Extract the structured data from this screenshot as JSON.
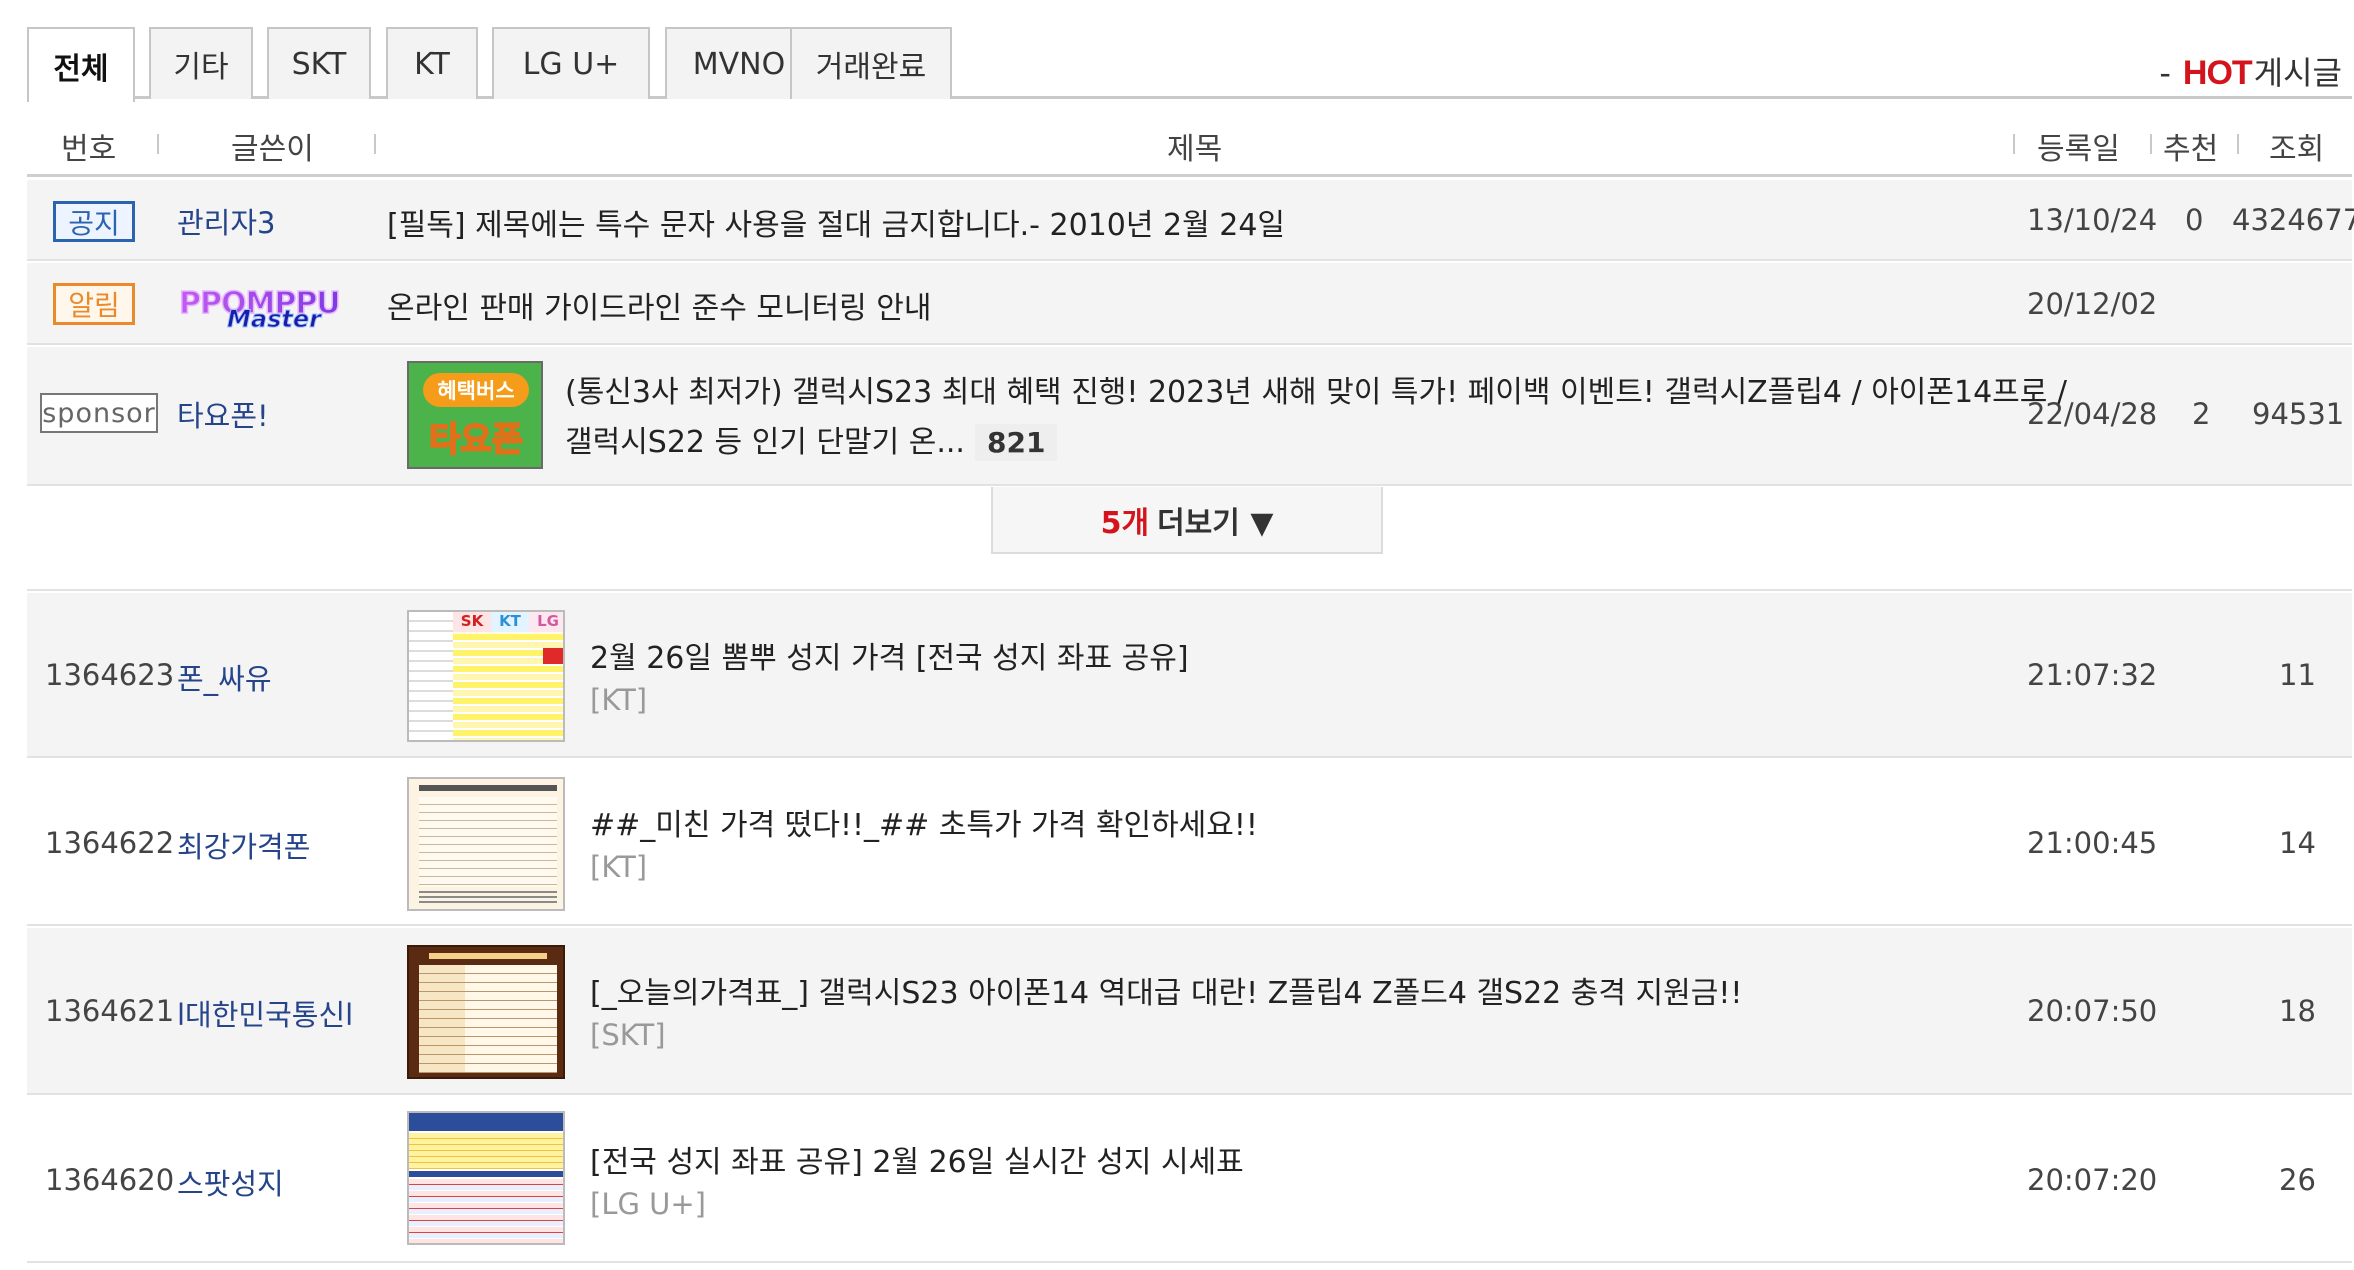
{
  "tabs": [
    {
      "label": "전체",
      "active": true
    },
    {
      "label": "기타"
    },
    {
      "label": "SKT"
    },
    {
      "label": "KT"
    },
    {
      "label": "LG U+"
    },
    {
      "label": "MVNO"
    },
    {
      "label": "거래완료"
    }
  ],
  "hot_link": {
    "dash": "-",
    "hot": "HOT",
    "board": "게시글"
  },
  "columns": {
    "no": "번호",
    "writer": "글쓴이",
    "title": "제목",
    "date": "등록일",
    "rec": "추천",
    "views": "조회"
  },
  "notices": [
    {
      "badge": "공지",
      "writer": "관리자3",
      "title": "[필독] 제목에는 특수 문자 사용을 절대 금지합니다.- 2010년 2월 24일",
      "date": "13/10/24",
      "rec": "0",
      "views": "4324677"
    },
    {
      "badge": "알림",
      "writer_logo": "PPOMPPU Master",
      "title": "온라인 판매 가이드라인 준수 모니터링 안내",
      "date": "20/12/02"
    },
    {
      "badge": "sponsor",
      "writer": "타요폰!",
      "thumb_text": [
        "혜택버스",
        "타요폰"
      ],
      "title_line1": "(통신3사 최저가) 갤럭시S23 최대 혜택 진행! 2023년 새해 맞이 특가! 페이백 이벤트! 갤럭시Z플립4 / 아이폰14프로 /",
      "title_line2": "갤럭시S22 등 인기 단말기 온...",
      "comments": "821",
      "date": "22/04/28",
      "rec": "2",
      "views": "94531"
    }
  ],
  "more": {
    "count": "5개",
    "label": "더보기 ▼"
  },
  "posts": [
    {
      "no": "1364623",
      "writer": "폰_싸유",
      "title": "2월 26일 뽐뿌 성지 가격 [전국 성지 좌표 공유]",
      "category": "[KT]",
      "time": "21:07:32",
      "views": "11",
      "thumb_headers": [
        "SK",
        "KT",
        "LG"
      ]
    },
    {
      "no": "1364622",
      "writer": "최강가격폰",
      "title": "##_미친 가격 떴다!!_## 초특가 가격 확인하세요!!",
      "category": "[KT]",
      "time": "21:00:45",
      "views": "14"
    },
    {
      "no": "1364621",
      "writer": "l대한민국통신l",
      "title": "[_오늘의가격표_] 갤럭시S23 아이폰14 역대급 대란! Z플립4 Z폴드4 갤S22 충격 지원금!!",
      "category": "[SKT]",
      "time": "20:07:50",
      "views": "18"
    },
    {
      "no": "1364620",
      "writer": "스팟성지",
      "title": "[전국 성지 좌표 공유] 2월 26일 실시간 성지 시세표",
      "category": "[LG U+]",
      "time": "20:07:20",
      "views": "26"
    }
  ],
  "colors": {
    "accent_red": "#d3141c",
    "writer_blue": "#25448a",
    "notice_blue": "#2a64b0",
    "alert_orange": "#ea8a2a",
    "sponsor_green": "#4bb34a"
  }
}
